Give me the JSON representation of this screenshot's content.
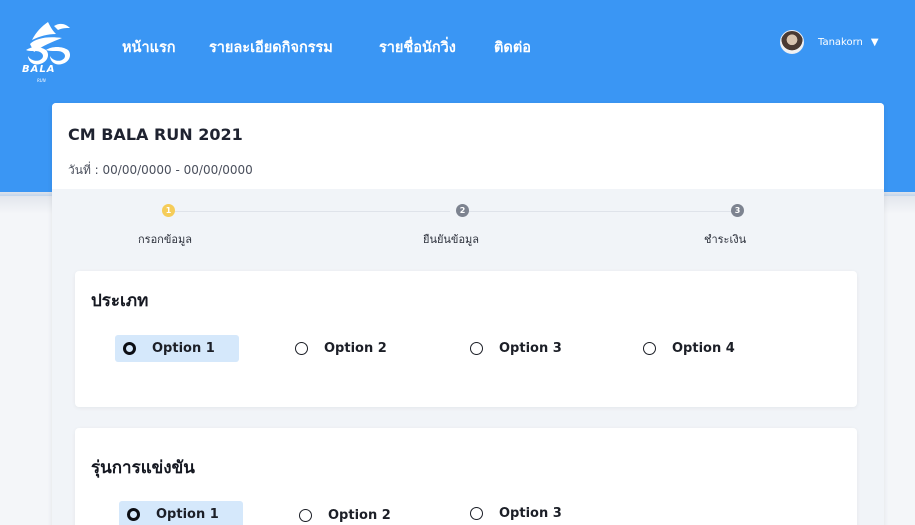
{
  "header": {
    "logo_text": "BALA",
    "logo_sub": "RUN",
    "nav": [
      "หน้าแรก",
      "รายละเอียดกิจกรรม",
      "รายชื่อนักวิ่ง",
      "ติดต่อ"
    ],
    "user_name": "Tanakorn",
    "user_caret": "▼"
  },
  "event": {
    "title": "CM BALA RUN 2021",
    "date": "วันที่ : 00/00/0000 - 00/00/0000"
  },
  "steps": [
    {
      "number": "1",
      "label": "กรอกข้อมูล",
      "active": true
    },
    {
      "number": "2",
      "label": "ยืนยันข้อมูล",
      "active": false
    },
    {
      "number": "3",
      "label": "ชำระเงิน",
      "active": false
    }
  ],
  "sections": [
    {
      "title": "ประเภท",
      "options": [
        "Option 1",
        "Option 2",
        "Option 3",
        "Option 4"
      ],
      "selected": "Option 1"
    },
    {
      "title": "รุ่นการแข่งขัน",
      "options": [
        "Option 1",
        "Option 2",
        "Option 3"
      ],
      "selected": "Option 1"
    }
  ],
  "colors": {
    "header_blue": "#3a96f4",
    "step_active": "#f5cc59",
    "step_inactive": "#7d8390",
    "selected_bg": "#d5e8fb"
  }
}
